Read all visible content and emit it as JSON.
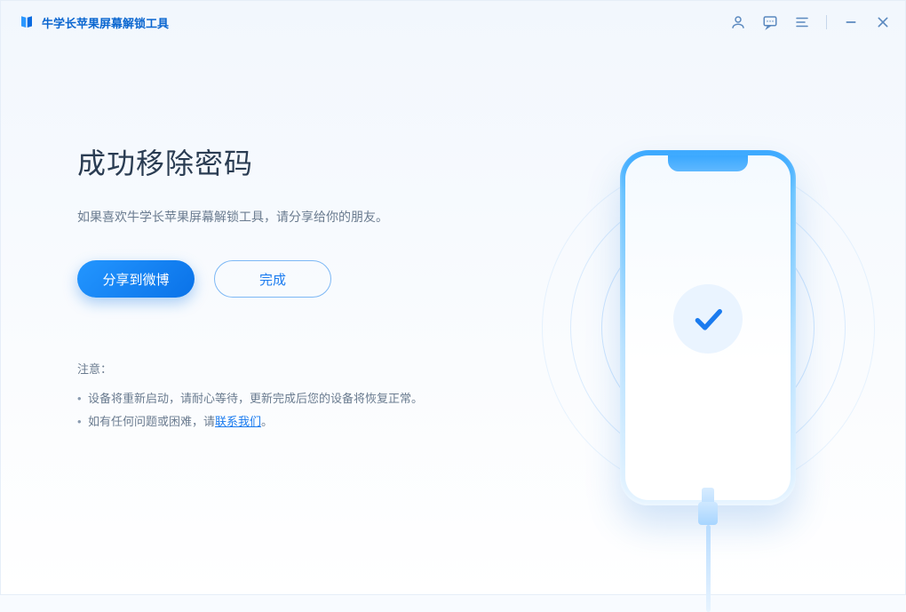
{
  "app": {
    "title": "牛学长苹果屏幕解锁工具"
  },
  "main": {
    "heading": "成功移除密码",
    "subtext": "如果喜欢牛学长苹果屏幕解锁工具，请分享给你的朋友。",
    "share_label": "分享到微博",
    "done_label": "完成"
  },
  "notes": {
    "title": "注意：",
    "item1": "设备将重新启动，请耐心等待，更新完成后您的设备将恢复正常。",
    "item2_prefix": "如有任何问题或困难，请",
    "item2_link": "联系我们",
    "item2_suffix": "。"
  }
}
